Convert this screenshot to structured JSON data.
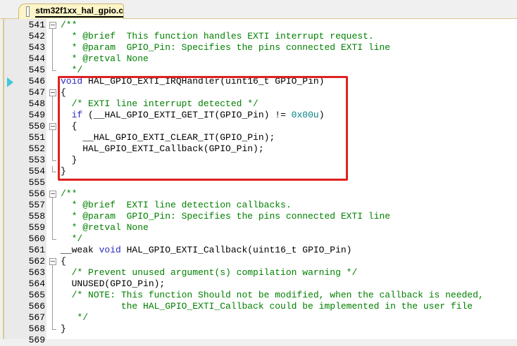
{
  "tab": {
    "filename": "stm32f1xx_hal_gpio.c"
  },
  "current_line": 546,
  "lines": [
    {
      "num": "541",
      "fold": "open",
      "tokens": [
        {
          "t": "/**",
          "c": "c"
        }
      ]
    },
    {
      "num": "542",
      "fold": "mid",
      "tokens": [
        {
          "t": "  * @brief  This function handles EXTI interrupt request.",
          "c": "c"
        }
      ]
    },
    {
      "num": "543",
      "fold": "mid",
      "tokens": [
        {
          "t": "  * @param  GPIO_Pin: Specifies the pins connected EXTI line",
          "c": "c"
        }
      ]
    },
    {
      "num": "544",
      "fold": "mid",
      "tokens": [
        {
          "t": "  * @retval None",
          "c": "c"
        }
      ]
    },
    {
      "num": "545",
      "fold": "end",
      "tokens": [
        {
          "t": "  */",
          "c": "c"
        }
      ]
    },
    {
      "num": "546",
      "fold": "none",
      "tokens": [
        {
          "t": "void",
          "c": "k"
        },
        {
          "t": " HAL_GPIO_EXTI_IRQHandler(uint16_t GPIO_Pin)",
          "c": ""
        }
      ]
    },
    {
      "num": "547",
      "fold": "open",
      "tokens": [
        {
          "t": "{",
          "c": ""
        }
      ]
    },
    {
      "num": "548",
      "fold": "mid",
      "tokens": [
        {
          "t": "  ",
          "c": ""
        },
        {
          "t": "/* EXTI line interrupt detected */",
          "c": "c"
        }
      ]
    },
    {
      "num": "549",
      "fold": "mid",
      "tokens": [
        {
          "t": "  ",
          "c": ""
        },
        {
          "t": "if",
          "c": "k"
        },
        {
          "t": " (__HAL_GPIO_EXTI_GET_IT(GPIO_Pin) != ",
          "c": ""
        },
        {
          "t": "0x00u",
          "c": "n"
        },
        {
          "t": ")",
          "c": ""
        }
      ]
    },
    {
      "num": "550",
      "fold": "open",
      "tokens": [
        {
          "t": "  {",
          "c": ""
        }
      ]
    },
    {
      "num": "551",
      "fold": "mid",
      "tokens": [
        {
          "t": "    __HAL_GPIO_EXTI_CLEAR_IT(GPIO_Pin);",
          "c": ""
        }
      ]
    },
    {
      "num": "552",
      "fold": "mid",
      "tokens": [
        {
          "t": "    HAL_GPIO_EXTI_Callback(GPIO_Pin);",
          "c": ""
        }
      ]
    },
    {
      "num": "553",
      "fold": "end",
      "tokens": [
        {
          "t": "  }",
          "c": ""
        }
      ]
    },
    {
      "num": "554",
      "fold": "end",
      "tokens": [
        {
          "t": "}",
          "c": ""
        }
      ]
    },
    {
      "num": "555",
      "fold": "none",
      "tokens": []
    },
    {
      "num": "556",
      "fold": "open",
      "tokens": [
        {
          "t": "/**",
          "c": "c"
        }
      ]
    },
    {
      "num": "557",
      "fold": "mid",
      "tokens": [
        {
          "t": "  * @brief  EXTI line detection callbacks.",
          "c": "c"
        }
      ]
    },
    {
      "num": "558",
      "fold": "mid",
      "tokens": [
        {
          "t": "  * @param  GPIO_Pin: Specifies the pins connected EXTI line",
          "c": "c"
        }
      ]
    },
    {
      "num": "559",
      "fold": "mid",
      "tokens": [
        {
          "t": "  * @retval None",
          "c": "c"
        }
      ]
    },
    {
      "num": "560",
      "fold": "end",
      "tokens": [
        {
          "t": "  */",
          "c": "c"
        }
      ]
    },
    {
      "num": "561",
      "fold": "none",
      "tokens": [
        {
          "t": "__weak ",
          "c": ""
        },
        {
          "t": "void",
          "c": "k"
        },
        {
          "t": " HAL_GPIO_EXTI_Callback(uint16_t GPIO_Pin)",
          "c": ""
        }
      ]
    },
    {
      "num": "562",
      "fold": "open",
      "tokens": [
        {
          "t": "{",
          "c": ""
        }
      ]
    },
    {
      "num": "563",
      "fold": "mid",
      "tokens": [
        {
          "t": "  ",
          "c": ""
        },
        {
          "t": "/* Prevent unused argument(s) compilation warning */",
          "c": "c"
        }
      ]
    },
    {
      "num": "564",
      "fold": "mid",
      "tokens": [
        {
          "t": "  UNUSED(GPIO_Pin);",
          "c": ""
        }
      ]
    },
    {
      "num": "565",
      "fold": "mid",
      "tokens": [
        {
          "t": "  ",
          "c": ""
        },
        {
          "t": "/* NOTE: This function Should not be modified, when the callback is needed,",
          "c": "c"
        }
      ]
    },
    {
      "num": "566",
      "fold": "mid",
      "tokens": [
        {
          "t": "           the HAL_GPIO_EXTI_Callback could be implemented in the user file",
          "c": "c"
        }
      ]
    },
    {
      "num": "567",
      "fold": "mid",
      "tokens": [
        {
          "t": "   */",
          "c": "c"
        }
      ]
    },
    {
      "num": "568",
      "fold": "end",
      "tokens": [
        {
          "t": "}",
          "c": ""
        }
      ]
    },
    {
      "num": "569",
      "fold": "none",
      "tokens": []
    }
  ]
}
